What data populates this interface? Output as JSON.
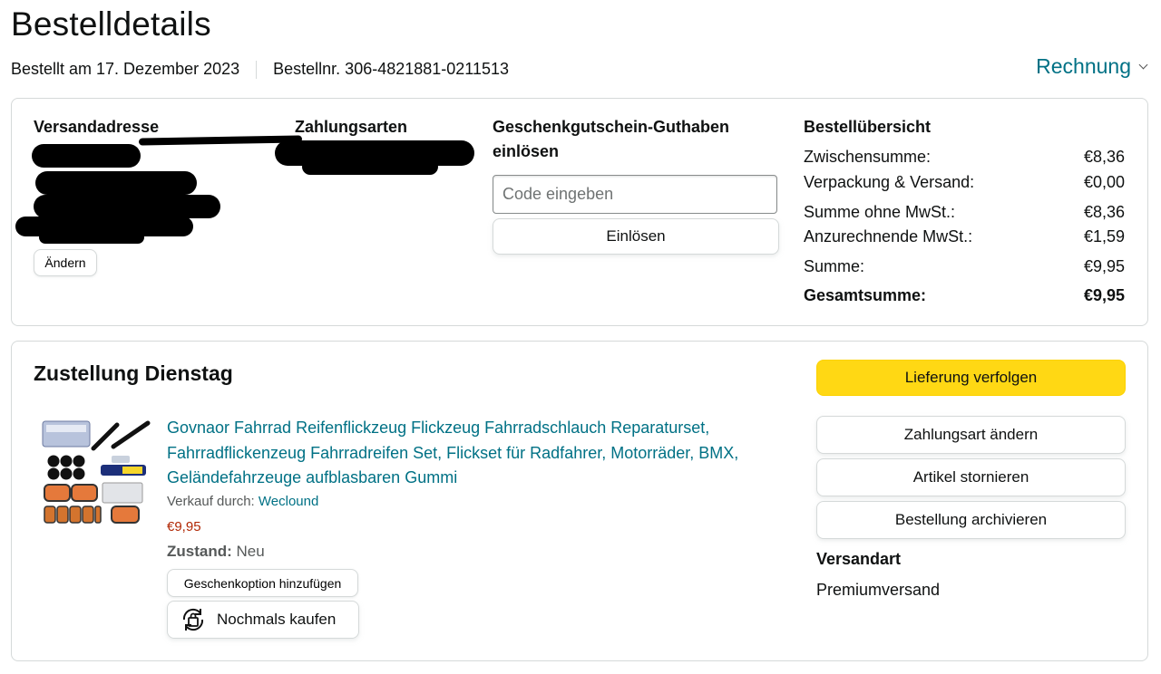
{
  "page": {
    "title": "Bestelldetails",
    "order_date": "Bestellt am 17. Dezember 2023",
    "order_number": "Bestellnr. 306-4821881-0211513",
    "invoice_label": "Rechnung"
  },
  "address": {
    "title": "Versandadresse",
    "change_label": "Ändern"
  },
  "payment": {
    "title": "Zahlungsarten"
  },
  "gift_card": {
    "title_line1": "Geschenkgutschein-Guthaben",
    "title_line2": "einlösen",
    "placeholder": "Code eingeben",
    "redeem_label": "Einlösen"
  },
  "summary": {
    "title": "Bestellübersicht",
    "rows": [
      {
        "label": "Zwischensumme:",
        "value": "€8,36"
      },
      {
        "label": "Verpackung & Versand:",
        "value": "€0,00"
      },
      {
        "label": "Summe ohne MwSt.:",
        "value": "€8,36"
      },
      {
        "label": "Anzurechnende MwSt.:",
        "value": "€1,59"
      },
      {
        "label": "Summe:",
        "value": "€9,95"
      },
      {
        "label": "Gesamtsumme:",
        "value": "€9,95"
      }
    ]
  },
  "delivery": {
    "title": "Zustellung Dienstag",
    "product_title": "Govnaor Fahrrad Reifenflickzeug Flickzeug Fahrradschlauch Reparaturset, Fahrradflickenzeug Fahrradreifen Set, Flickset für Radfahrer, Motorräder, BMX, Geländefahrzeuge aufblasbaren Gummi",
    "seller_prefix": "Verkauf durch:",
    "seller_name": "Weclound",
    "price": "€9,95",
    "condition_label": "Zustand:",
    "condition_value": "Neu",
    "gift_option_label": "Geschenkoption hinzufügen",
    "buy_again_label": "Nochmals kaufen",
    "track_label": "Lieferung verfolgen",
    "change_payment_label": "Zahlungsart ändern",
    "cancel_label": "Artikel stornieren",
    "archive_label": "Bestellung archivieren",
    "shipping_title": "Versandart",
    "shipping_value": "Premiumversand"
  },
  "colors": {
    "link": "#007185",
    "price": "#b12704",
    "primary_button": "#ffd814",
    "border": "#d5d9d9"
  }
}
